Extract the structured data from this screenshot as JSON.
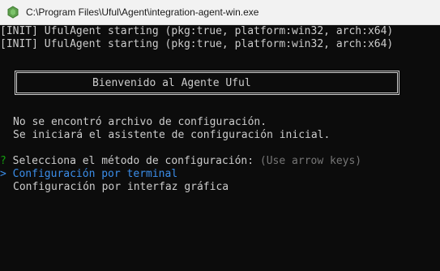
{
  "window": {
    "title": "C:\\Program Files\\Uful\\Agent\\integration-agent-win.exe",
    "icon": "node-hexagon-icon"
  },
  "console": {
    "init_lines": [
      "[INIT] UfulAgent starting (pkg:true, platform:win32, arch:x64)",
      "[INIT] UfulAgent starting (pkg:true, platform:win32, arch:x64)"
    ],
    "banner_text": "Bienvenido al Agente Uful",
    "messages": [
      "No se encontró archivo de configuración.",
      "Se iniciará el asistente de configuración inicial."
    ],
    "prompt": {
      "marker": "?",
      "question": "Selecciona el método de configuración:",
      "hint": "(Use arrow keys)"
    },
    "options": {
      "pointer": ">",
      "selected": "Configuración por terminal",
      "other": "Configuración por interfaz gráfica"
    }
  },
  "colors": {
    "background": "#0c0c0c",
    "text": "#cccccc",
    "prompt_marker": "#13a10e",
    "selected_option": "#3b8eea",
    "hint": "#767676"
  }
}
